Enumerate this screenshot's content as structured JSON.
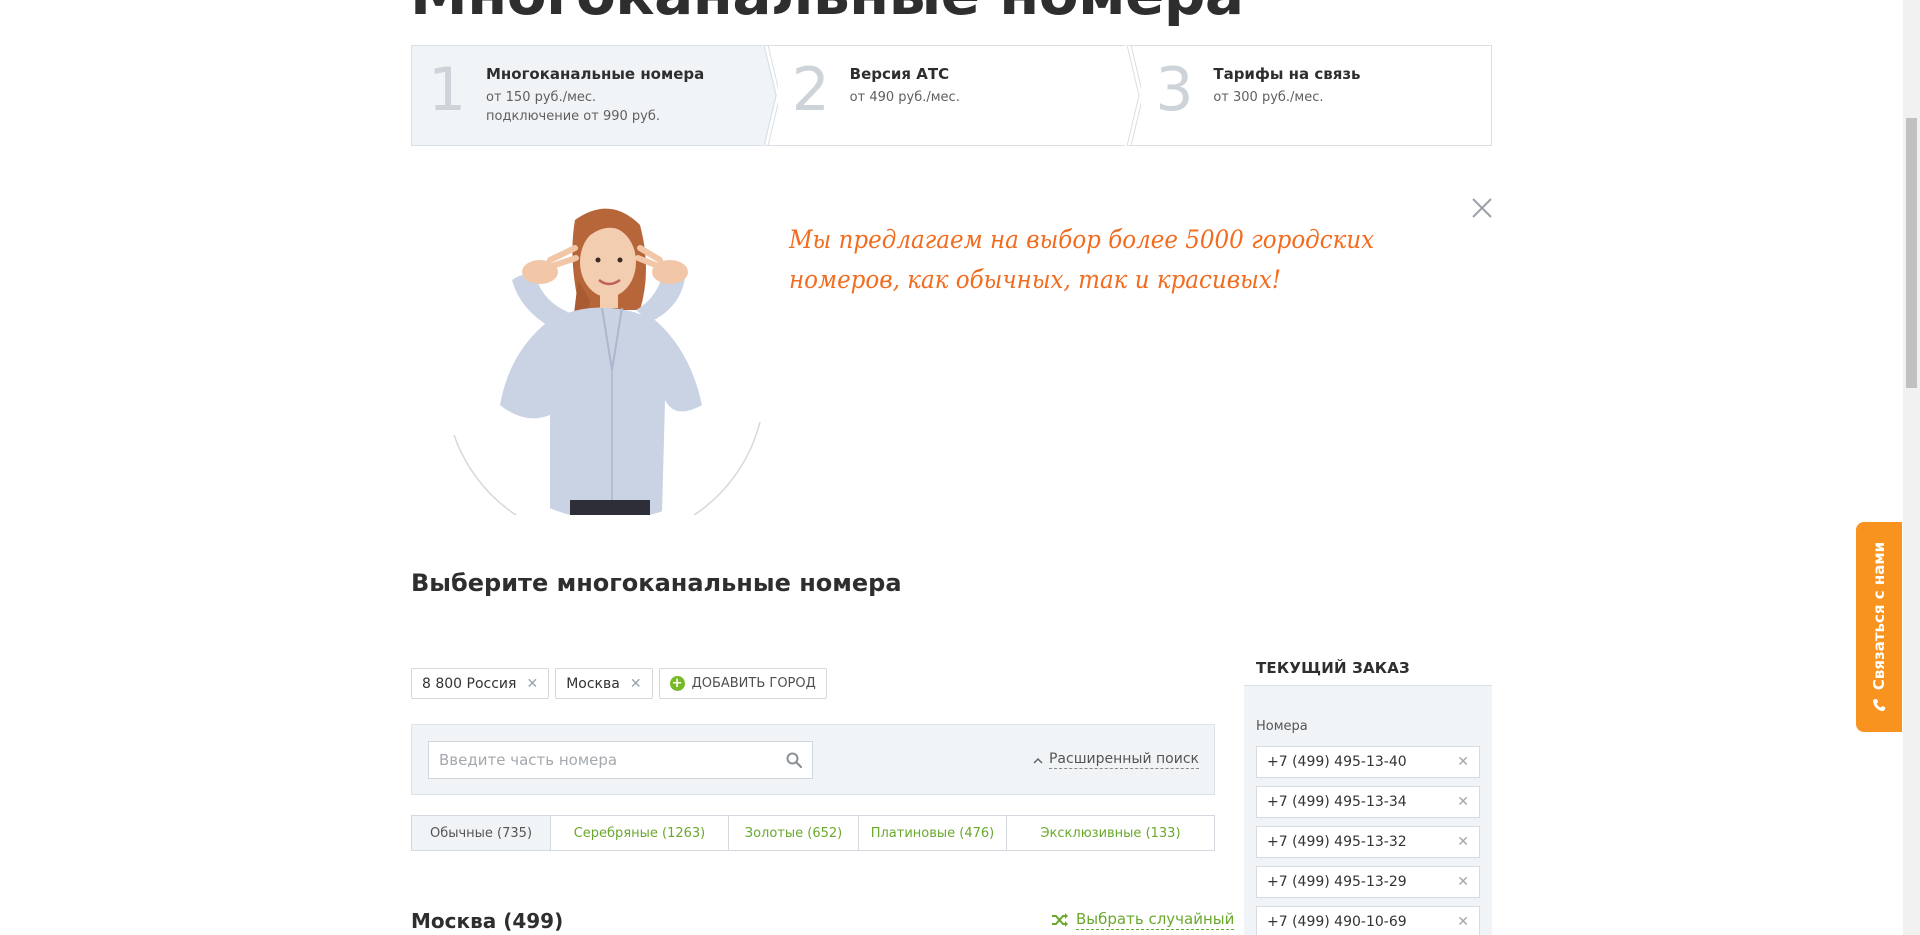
{
  "page": {
    "heading": "Многоканальные номера"
  },
  "steps": [
    {
      "num": "1",
      "title": "Многоканальные номера",
      "desc1": "от 150 руб./мес.",
      "desc2": "подключение от 990 руб."
    },
    {
      "num": "2",
      "title": "Версия АТС",
      "desc1": "от 490 руб./мес.",
      "desc2": ""
    },
    {
      "num": "3",
      "title": "Тарифы на связь",
      "desc1": "от 300 руб./мес.",
      "desc2": ""
    }
  ],
  "promo": {
    "text": "Мы предлагаем на выбор более 5000 городских номеров, как обычных, так и красивых!"
  },
  "section": {
    "title": "Выберите многоканальные номера"
  },
  "cities": {
    "chips": [
      "8 800 Россия",
      "Москва"
    ],
    "add_label": "Добавить город"
  },
  "search": {
    "placeholder": "Введите часть номера",
    "value": "",
    "advanced_label": "Расширенный поиск"
  },
  "tabs": [
    {
      "label": "Обычные (735)",
      "active": true
    },
    {
      "label": "Серебряные (1263)",
      "active": false
    },
    {
      "label": "Золотые (652)",
      "active": false
    },
    {
      "label": "Платиновые (476)",
      "active": false
    },
    {
      "label": "Эксклюзивные (133)",
      "active": false
    }
  ],
  "results": {
    "city_heading": "Москва (499)",
    "random_label": "Выбрать случайный"
  },
  "order": {
    "title": "ТЕКУЩИЙ ЗАКАЗ",
    "numbers_label": "Номера",
    "numbers": [
      "+7 (499) 495-13-40",
      "+7 (499) 495-13-34",
      "+7 (499) 495-13-32",
      "+7 (499) 495-13-29",
      "+7 (499) 490-10-69"
    ]
  },
  "contact": {
    "label": "Связаться с нами"
  },
  "colors": {
    "accent_orange": "#f26c1f",
    "contact_orange": "#f7931e",
    "green": "#6aa82d",
    "panel_bg": "#f1f4f7"
  }
}
